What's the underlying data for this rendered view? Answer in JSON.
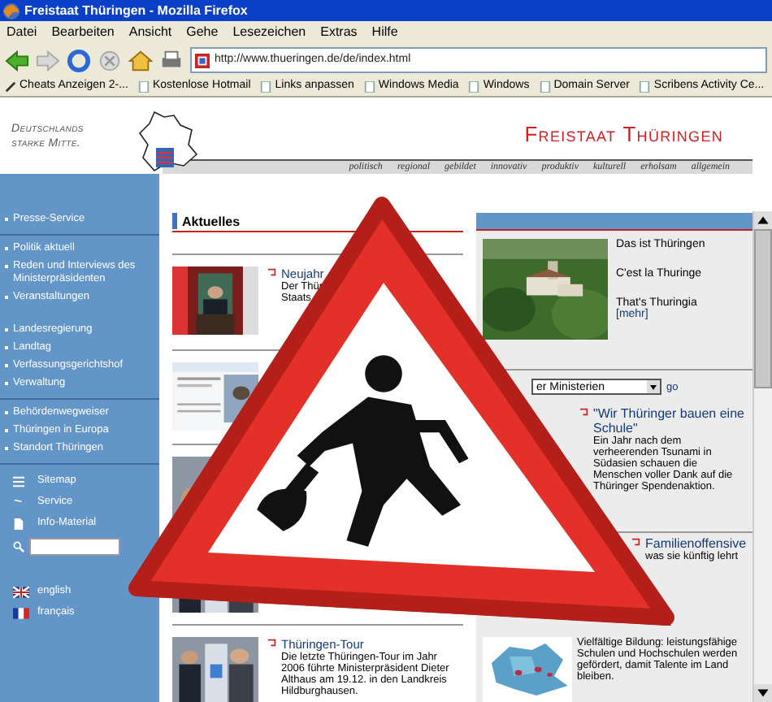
{
  "window": {
    "title": "Freistaat Thüringen - Mozilla Firefox"
  },
  "menu": [
    "Datei",
    "Bearbeiten",
    "Ansicht",
    "Gehe",
    "Lesezeichen",
    "Extras",
    "Hilfe"
  ],
  "address": {
    "value": "http://www.thueringen.de/de/index.html"
  },
  "bookmarks": [
    {
      "kind": "special",
      "label": "Cheats Anzeigen 2-..."
    },
    {
      "kind": "page",
      "label": "Kostenlose Hotmail"
    },
    {
      "kind": "page",
      "label": "Links anpassen"
    },
    {
      "kind": "page",
      "label": "Windows Media"
    },
    {
      "kind": "page",
      "label": "Windows"
    },
    {
      "kind": "page",
      "label": "Domain Server"
    },
    {
      "kind": "page",
      "label": "Scribens Activity Ce..."
    }
  ],
  "header": {
    "slogan": [
      "Deutschlands",
      "starke Mitte."
    ],
    "title": "Freistaat Thüringen"
  },
  "topnav": [
    "politisch",
    "regional",
    "gebildet",
    "innovativ",
    "produktiv",
    "kulturell",
    "erholsam",
    "allgemein"
  ],
  "sidebar": {
    "sections": [
      [
        [
          "Presse-Service"
        ]
      ],
      [
        [
          "Politik aktuell",
          "Reden und Interviews des Ministerpräsidenten",
          "Veranstaltungen"
        ],
        [
          "Landesregierung",
          "Landtag",
          "Verfassungsgerichtshof",
          "Verwaltung"
        ]
      ],
      [
        [
          "Behördenwegweiser",
          "Thüringen in Europa",
          "Standort Thüringen"
        ]
      ]
    ],
    "tools": [
      {
        "kind": "sitemap",
        "label": "Sitemap"
      },
      {
        "kind": "service",
        "label": "Service"
      },
      {
        "kind": "info",
        "label": "Info-Material"
      }
    ],
    "search": {
      "kind": "search"
    },
    "languages": [
      {
        "kind": "en",
        "label": "english"
      },
      {
        "kind": "fr",
        "label": "français"
      }
    ]
  },
  "content": {
    "heading": "Aktuelles",
    "news": [
      {
        "kind": "top",
        "title": "Neujahr",
        "lines": [
          "Der Thür",
          "Staats"
        ]
      },
      {
        "kind": "brochure"
      },
      {
        "kind": "hidden"
      },
      {
        "kind": "bottom",
        "title": "Thüringen-Tour",
        "lines": [
          "Die letzte Thüringen-Tour im Jahr",
          "2006 führte Ministerpräsident Dieter",
          "Althaus am 19.12. in den Landkreis",
          "Hildburghausen."
        ]
      }
    ]
  },
  "panel": {
    "links": [
      "Das ist Thüringen",
      "C'est la Thuringe",
      "That's Thuringia"
    ],
    "more": "[mehr]",
    "select": {
      "value": "er Ministerien"
    },
    "go": "go",
    "items": [
      {
        "kind": "full",
        "title": "\"Wir Thüringer bauen eine Schule\"",
        "text": "Ein Jahr nach dem verheerenden Tsunami in Südasien schauen die Menschen voller Dank auf die Thüringer Spendenaktion."
      },
      {
        "kind": "cut",
        "title": "Familienoffensive",
        "text": "was sie künftig lehrt"
      },
      {
        "kind": "map",
        "text": "Vielfältige Bildung: leistungsfähige Schulen und Hochschulen werden gefördert, damit Talente im Land bleiben."
      }
    ]
  }
}
